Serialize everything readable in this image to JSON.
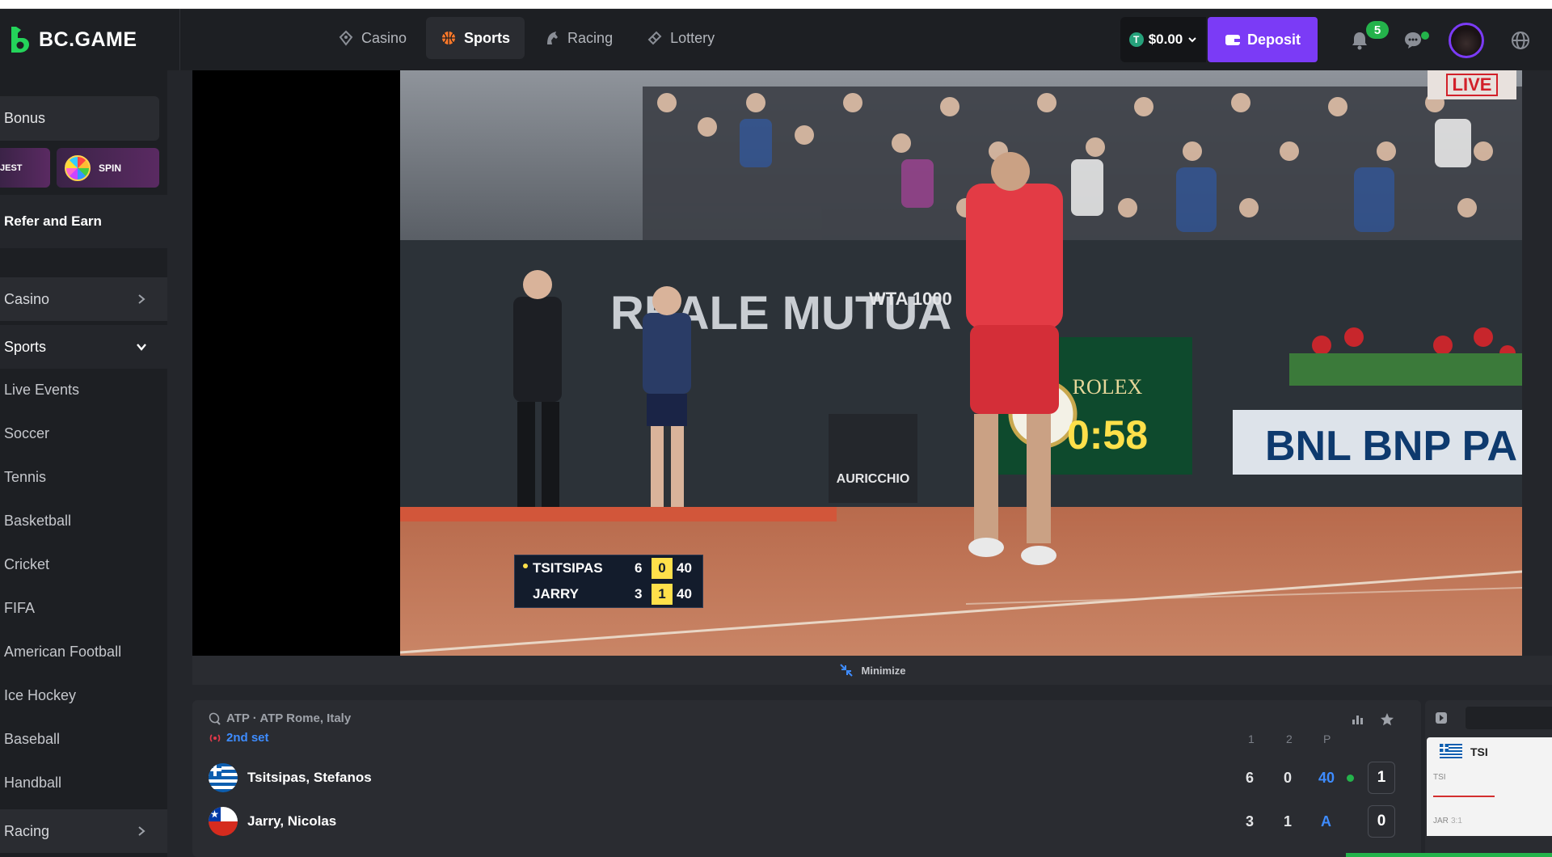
{
  "brand": {
    "name": "BC.GAME"
  },
  "nav": [
    {
      "label": "Casino",
      "icon": "casino-icon",
      "active": false
    },
    {
      "label": "Sports",
      "icon": "basketball-icon",
      "active": true
    },
    {
      "label": "Racing",
      "icon": "horse-icon",
      "active": false
    },
    {
      "label": "Lottery",
      "icon": "ticket-icon",
      "active": false
    }
  ],
  "header": {
    "balance": "$0.00",
    "deposit_label": "Deposit",
    "notifications_count": "5"
  },
  "sidebar": {
    "bonus": "Bonus",
    "quest": "JEST",
    "spin": "SPIN",
    "refer": "Refer and Earn",
    "casino": "Casino",
    "sports": "Sports",
    "sports_items": [
      "Live Events",
      "Soccer",
      "Tennis",
      "Basketball",
      "Cricket",
      "FIFA",
      "American Football",
      "Ice Hockey",
      "Baseball",
      "Handball"
    ],
    "racing": "Racing"
  },
  "video": {
    "live_badge": "LIVE",
    "brands": {
      "banner_left": "REALE MUTUA",
      "wta": "WTA 1000",
      "rolex": "ROLEX",
      "clock": "0:58",
      "bnl": "BNL BNP PA",
      "auricchio": "AURICCHIO"
    },
    "overlay": [
      {
        "name": "TSITSIPAS",
        "set1": "6",
        "set2": "0",
        "points": "40",
        "serving": true
      },
      {
        "name": "JARRY",
        "set1": "3",
        "set2": "1",
        "points": "40",
        "serving": false
      }
    ]
  },
  "minimize_label": "Minimize",
  "match": {
    "league": "ATP · ATP Rome, Italy",
    "status": "2nd set",
    "columns": [
      "1",
      "2",
      "P"
    ],
    "players": [
      {
        "name": "Tsitsipas, Stefanos",
        "set1": "6",
        "set2": "0",
        "points": "40",
        "sets": "1",
        "serving": true,
        "flag": "greece"
      },
      {
        "name": "Jarry, Nicolas",
        "set1": "3",
        "set2": "1",
        "points": "A",
        "sets": "0",
        "serving": false,
        "flag": "chile"
      }
    ]
  },
  "mini_tracker": {
    "team_a": "TSI",
    "team_a_short": "TSI",
    "team_b_short": "JAR",
    "score_b": "3:1"
  },
  "colors": {
    "accent": "#7b3bf6",
    "green": "#24b34b",
    "blue": "#3e8cff",
    "bg": "#24262b",
    "panel": "#2a2c31"
  }
}
